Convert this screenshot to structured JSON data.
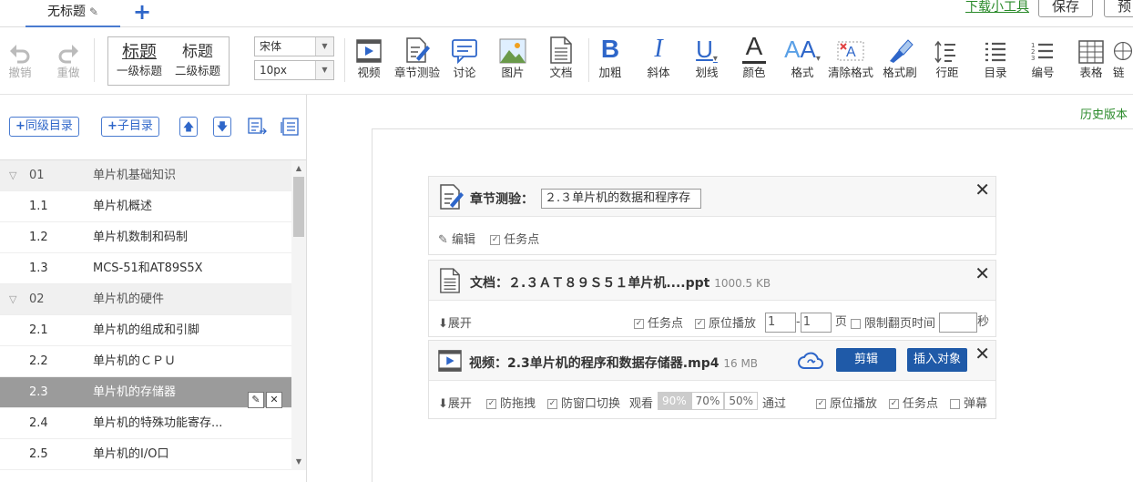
{
  "tabs": {
    "current": "无标题",
    "add": "+"
  },
  "top_right": {
    "download": "下载小工具",
    "save": "保存",
    "preview": "预"
  },
  "toolbar": {
    "undo": "撤销",
    "redo": "重做",
    "heading1_big": "标题",
    "heading1_small": "一级标题",
    "heading2_big": "标题",
    "heading2_small": "二级标题",
    "font_family": "宋体",
    "font_size": "10px",
    "video": "视频",
    "chapter_quiz": "章节测验",
    "discussion": "讨论",
    "image": "图片",
    "document": "文档",
    "bold": "加粗",
    "italic": "斜体",
    "underline": "划线",
    "color": "颜色",
    "format": "格式",
    "clear_format": "清除格式",
    "format_painter": "格式刷",
    "line_spacing": "行距",
    "toc": "目录",
    "numbering": "编号",
    "table": "表格",
    "extra": "链"
  },
  "sidebar": {
    "same_level": "同级目录",
    "sub_level": "子目录",
    "items": [
      {
        "num": "01",
        "title": "单片机基础知识",
        "chapter": true
      },
      {
        "num": "1.1",
        "title": "单片机概述"
      },
      {
        "num": "1.2",
        "title": "单片机数制和码制"
      },
      {
        "num": "1.3",
        "title": "MCS-51和AT89S5X"
      },
      {
        "num": "02",
        "title": "单片机的硬件",
        "chapter": true
      },
      {
        "num": "2.1",
        "title": "单片机的组成和引脚"
      },
      {
        "num": "2.2",
        "title": "单片机的ＣＰＵ"
      },
      {
        "num": "2.3",
        "title": "单片机的存储器",
        "selected": true
      },
      {
        "num": "2.4",
        "title": "单片机的特殊功能寄存..."
      },
      {
        "num": "2.5",
        "title": "单片机的I/O口"
      }
    ]
  },
  "history": "历史版本",
  "quiz_card": {
    "label": "章节测验：",
    "value": "２.３单片机的数据和程序存",
    "edit": "编辑",
    "task_point": "任务点"
  },
  "doc_card": {
    "label": "文档：",
    "filename": "２.３ＡＴ８９Ｓ５１单片机....ppt",
    "size": "1000.5 KB",
    "expand": "展开",
    "task_point": "任务点",
    "inplace": "原位播放",
    "from": "1",
    "to": "1",
    "page": "页",
    "limit": "限制翻页时间",
    "sec": "秒"
  },
  "video_card": {
    "label": "视频：",
    "filename": "2.3单片机的程序和数据存储器.mp4",
    "size": "16 MB",
    "edit": "剪辑",
    "insert": "插入对象",
    "expand": "展开",
    "anti_drag": "防拖拽",
    "anti_switch": "防窗口切换",
    "watch": "观看",
    "p90": "90%",
    "p70": "70%",
    "p50": "50%",
    "pass": "通过",
    "inplace": "原位播放",
    "task_point": "任务点",
    "popup": "弹幕"
  }
}
